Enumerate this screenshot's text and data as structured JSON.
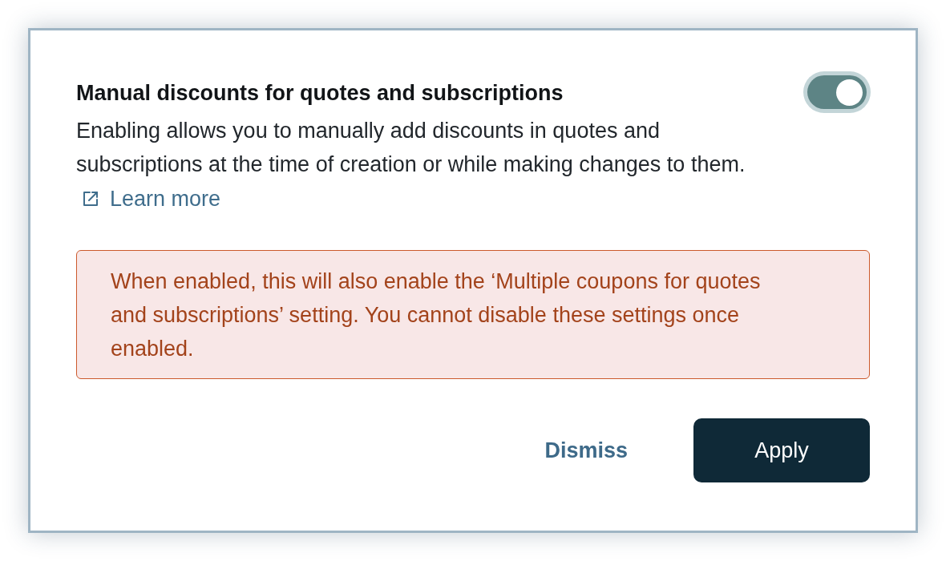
{
  "dialog": {
    "title": "Manual discounts for quotes and subscriptions",
    "toggle": {
      "on": true
    },
    "description": "Enabling allows you to manually add discounts in quotes and subscriptions at the time of creation or while making changes to them.",
    "learn_more_link": "Learn more",
    "warning": "When enabled, this will also enable the ‘Multiple coupons for quotes and subscriptions’ setting. You cannot disable these settings once enabled.",
    "buttons": [
      {
        "label": "Dismiss",
        "kind": "secondary"
      },
      {
        "label": "Apply",
        "kind": "primary"
      }
    ]
  }
}
